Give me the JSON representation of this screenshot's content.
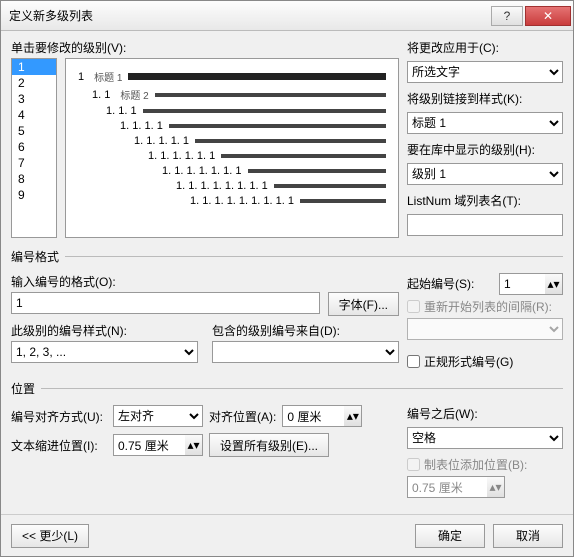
{
  "title": "定义新多级列表",
  "titlebar": {
    "help": "?",
    "close": "✕"
  },
  "top": {
    "click_level_label": "单击要修改的级别(V):",
    "levels": [
      "1",
      "2",
      "3",
      "4",
      "5",
      "6",
      "7",
      "8",
      "9"
    ],
    "selected_level": "1",
    "apply_to_label": "将更改应用于(C):",
    "apply_to_value": "所选文字",
    "link_style_label": "将级别链接到样式(K):",
    "link_style_value": "标题 1",
    "gallery_level_label": "要在库中显示的级别(H):",
    "gallery_level_value": "级别 1",
    "listnum_label": "ListNum 域列表名(T):",
    "listnum_value": ""
  },
  "preview": {
    "rows": [
      {
        "indent": 0,
        "num": "1",
        "sub": "标题 1",
        "thick": true
      },
      {
        "indent": 1,
        "num": "1. 1",
        "sub": "标题 2",
        "thick": false
      },
      {
        "indent": 2,
        "num": "1. 1. 1",
        "sub": "",
        "thick": false
      },
      {
        "indent": 3,
        "num": "1. 1. 1. 1",
        "sub": "",
        "thick": false
      },
      {
        "indent": 4,
        "num": "1. 1. 1. 1. 1",
        "sub": "",
        "thick": false
      },
      {
        "indent": 5,
        "num": "1. 1. 1. 1. 1. 1",
        "sub": "",
        "thick": false
      },
      {
        "indent": 6,
        "num": "1. 1. 1. 1. 1. 1. 1",
        "sub": "",
        "thick": false
      },
      {
        "indent": 7,
        "num": "1. 1. 1. 1. 1. 1. 1. 1",
        "sub": "",
        "thick": false
      },
      {
        "indent": 8,
        "num": "1. 1. 1. 1. 1. 1. 1. 1. 1",
        "sub": "",
        "thick": false
      }
    ]
  },
  "fmt": {
    "group_title": "编号格式",
    "enter_fmt_label": "输入编号的格式(O):",
    "enter_fmt_value": "1",
    "font_btn": "字体(F)...",
    "style_label": "此级别的编号样式(N):",
    "style_value": "1, 2, 3, ...",
    "include_from_label": "包含的级别编号来自(D):",
    "include_from_value": "",
    "start_at_label": "起始编号(S):",
    "start_at_value": "1",
    "restart_label": "重新开始列表的间隔(R):",
    "restart_value": "",
    "legal_label": "正规形式编号(G)"
  },
  "pos": {
    "group_title": "位置",
    "align_label": "编号对齐方式(U):",
    "align_value": "左对齐",
    "align_at_label": "对齐位置(A):",
    "align_at_value": "0 厘米",
    "indent_label": "文本缩进位置(I):",
    "indent_value": "0.75 厘米",
    "set_all_btn": "设置所有级别(E)...",
    "follow_label": "编号之后(W):",
    "follow_value": "空格",
    "tab_label": "制表位添加位置(B):",
    "tab_value": "0.75 厘米"
  },
  "footer": {
    "less_btn": "<< 更少(L)",
    "ok_btn": "确定",
    "cancel_btn": "取消"
  }
}
